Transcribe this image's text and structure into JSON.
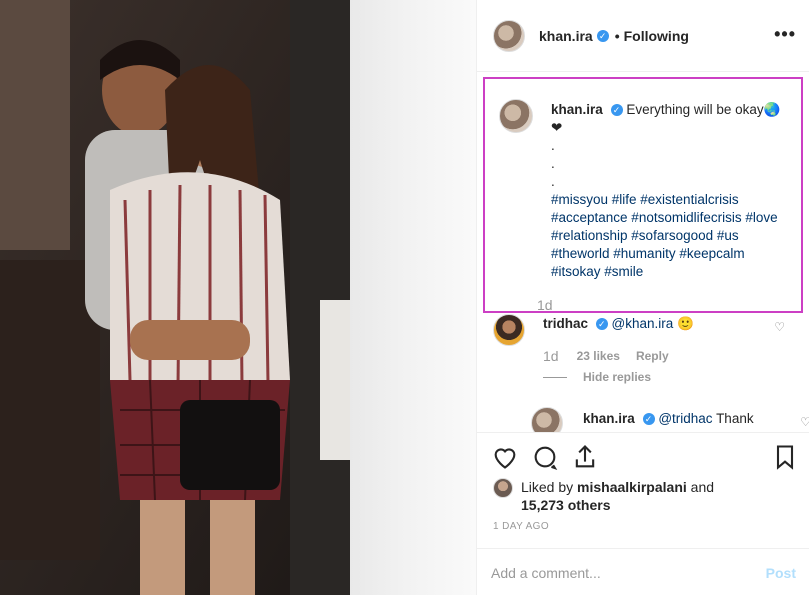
{
  "post": {
    "username": "khan.ira",
    "separator": "•",
    "follow_status": "Following",
    "more_icon": "more-horizontal-icon"
  },
  "caption": {
    "username": "khan.ira",
    "text": "Everything will be okay🌏",
    "emoji_line": "❤",
    "dots": [
      ".",
      ".",
      "."
    ],
    "hashtag_lines": [
      "#missyou #life #existentialcrisis",
      "#acceptance #notsomidlifecrisis #love",
      "#relationship #sofarsogood #us",
      "#theworld #humanity #keepcalm",
      "#itsokay #smile"
    ],
    "time": "1d"
  },
  "comment": {
    "username": "tridhac",
    "mention": "@khan.ira",
    "trail": "🙂",
    "time": "1d",
    "likes": "23 likes",
    "reply_label": "Reply",
    "hide_replies": "Hide replies"
  },
  "reply": {
    "username": "khan.ira",
    "mention": "@tridhac",
    "text": "Thank"
  },
  "likes": {
    "liked_by_prefix": "Liked by",
    "liked_by_user": "mishaalkirpalani",
    "and": "and",
    "others": "15,273 others"
  },
  "timestamp": "1 DAY AGO",
  "add_comment": {
    "placeholder": "Add a comment...",
    "post_label": "Post"
  },
  "colors": {
    "highlight_border": "#cc3fc4",
    "hashtag": "#003569",
    "verified": "#3897f0",
    "post_disabled": "#b2dffc"
  }
}
